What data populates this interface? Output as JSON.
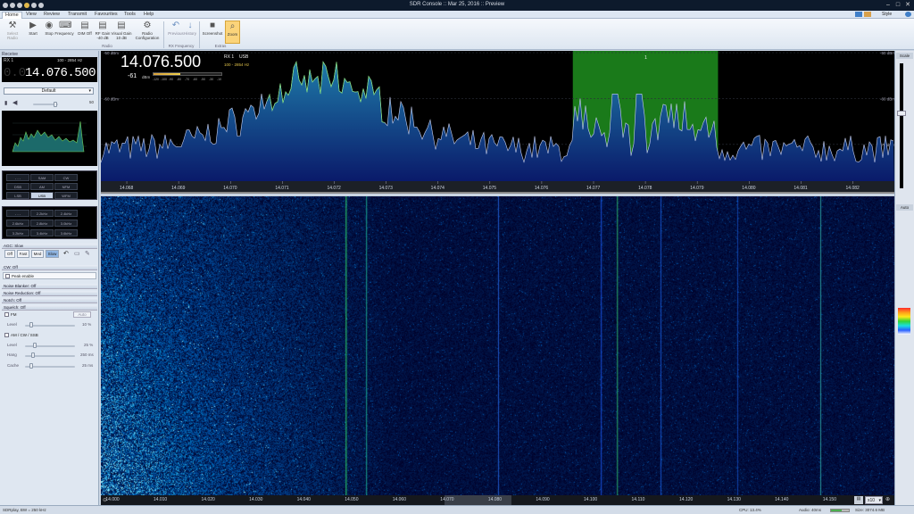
{
  "window": {
    "title": "SDR Console :: Mar 25, 2016 :: Preview",
    "style_label": "Style"
  },
  "menu": [
    "Home",
    "View",
    "Review",
    "Transmit",
    "Favourites",
    "Tools",
    "Help"
  ],
  "ribbon": {
    "buttons": [
      {
        "label": "Select Radio",
        "icon": "radio-select-icon"
      },
      {
        "label": "Start",
        "icon": "play-icon"
      },
      {
        "label": "Stop",
        "icon": "stop-icon"
      },
      {
        "label": "Frequency",
        "icon": "keyboard-icon"
      },
      {
        "label": "DIM Off",
        "icon": "dim-icon"
      },
      {
        "label": "RF Gain -40 dB",
        "icon": "gain-icon"
      },
      {
        "label": "Visual Gain 10 dB",
        "icon": "visual-gain-icon"
      },
      {
        "label": "Radio Configuration",
        "icon": "config-icon"
      },
      {
        "label": "Previous",
        "icon": "undo-icon"
      },
      {
        "label": "History",
        "icon": "history-icon"
      },
      {
        "label": "Screenshot",
        "icon": "camera-icon"
      },
      {
        "label": "Zoom",
        "icon": "zoom-icon"
      }
    ],
    "groups": [
      "Radio",
      "RX Frequency",
      "Extras"
    ]
  },
  "left": {
    "panel_title": "Receive",
    "rx_label": "RX 1",
    "bw": "100 - 2854 Hz",
    "freq_dim": "0.0",
    "freq": "14.076.500",
    "preset": "Default",
    "volume_value": "50",
    "modes": [
      "- - -",
      "SAM",
      "CW",
      "DSB",
      "AM",
      "NFM",
      "LSB",
      "USB",
      "WFM"
    ],
    "selected_mode": "USB",
    "filters": [
      "- - -",
      "2.2kHz",
      "2.4kHz",
      "2.6kHz",
      "2.8kHz",
      "3.0kHz",
      "3.2kHz",
      "3.4kHz",
      "3.6kHz"
    ],
    "agc_title": "AGC: Slow",
    "agc_buttons": [
      "Off",
      "Fast",
      "Med",
      "Slow"
    ],
    "selected_agc": "Slow",
    "cw_title": "CW: Off",
    "peak_label": "Peak enable",
    "sections": [
      "Noise Blanker: Off",
      "Noise Reduction: Off",
      "Notch: Off",
      "Squelch: Off"
    ],
    "squelch": {
      "fm_label": "FM",
      "auto_label": "Auto",
      "fm_level_label": "Level",
      "fm_level_value": "10 %",
      "am_label": "AM / CW / SSB",
      "level_label": "Level",
      "level_value": "25 %",
      "hang_label": "Hang",
      "hang_value": "250 ms",
      "cache_label": "Cache",
      "cache_value": "25 ms"
    }
  },
  "spectrum": {
    "freq": "14.076.500",
    "rx_label": "RX 1",
    "mode": "USB",
    "bw": "100 - 2854 Hz",
    "signal": "-61",
    "signal_unit": "dBm",
    "smeter_ticks": [
      "-120",
      "-100",
      "-90",
      "-80",
      "-70",
      "-60",
      "-50",
      "-30",
      "-10"
    ],
    "db_labels": [
      "-50 dBm",
      "-60 dBm",
      "-70 dBm"
    ],
    "db_values": [
      -50,
      -60,
      -70
    ],
    "db_range": [
      -50,
      -78
    ],
    "axis": [
      "14.068",
      "14.069",
      "14.070",
      "14.071",
      "14.072",
      "14.073",
      "14.074",
      "14.075",
      "14.076",
      "14.077",
      "14.078",
      "14.079",
      "14.080",
      "14.081",
      "14.082"
    ],
    "axis_range": [
      14.0675,
      14.0828
    ],
    "filter_range": [
      14.0766,
      14.0794
    ],
    "filter_label": "1",
    "colors": {
      "filter": "#1f8f1f",
      "trace": "#c8d0f0",
      "fill_top": "#1e7aa8",
      "fill_bottom": "#0a1a6a",
      "hot": "#7fe07a"
    }
  },
  "waterfall": {
    "axis": [
      "14.000",
      "14.010",
      "14.020",
      "14.030",
      "14.040",
      "14.050",
      "14.060",
      "14.070",
      "14.080",
      "14.090",
      "14.100",
      "14.110",
      "14.120",
      "14.130",
      "14.140",
      "14.150"
    ],
    "axis_range": [
      13.9975,
      14.1635
    ],
    "zoom": "x10"
  },
  "right": {
    "scale_label": "Scale",
    "auto_label": "Auto"
  },
  "status": {
    "left": "SDRplay, BW = 250 kHz",
    "cpu": "CPU: 13.4%",
    "audio": "Audio: 40ms",
    "size": "Size: 3074.6 MB"
  }
}
